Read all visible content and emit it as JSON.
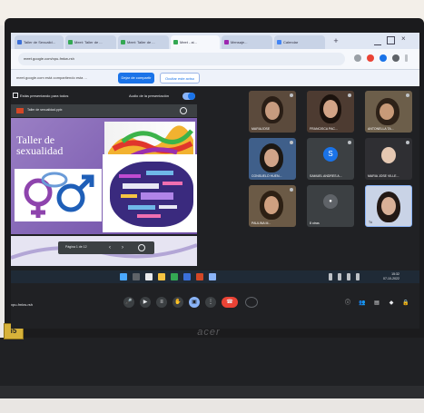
{
  "browser": {
    "tabs": [
      "Taller de Sexualid...",
      "Meet: Taller de ...",
      "Meet: Taller de ...",
      "Meet - ai...",
      "Mensaje...",
      "Calendar"
    ],
    "new_tab": "+",
    "url": "meet.google.com/xpu-fmkw-rsh"
  },
  "infobar": {
    "text": "meet.google.com está compartiendo esta ...",
    "share_label": "Dejar de compartir",
    "hide_label": "Ocultar este aviso"
  },
  "meet": {
    "presenting_label": "Estás presentando para todos",
    "audio_label": "Audio de la presentación",
    "activity_label": "Más actividades",
    "slides_toolbar": "Taller de sexualidad.pptx",
    "slide": {
      "title_line1": "Taller de",
      "title_line2": "sexualidad"
    },
    "slide_control": "Página 1 de 12",
    "meeting_code": "xpu-fmkw-rsh"
  },
  "participants": [
    {
      "name": "MARIAJOSE"
    },
    {
      "name": "FRANCISCA PAC..."
    },
    {
      "name": "ANTONELLA TA..."
    },
    {
      "name": "CONSUELO HUEN..."
    },
    {
      "name": "SAMUEL ANDRES A...",
      "avatar": "S"
    },
    {
      "name": "MARIA JOSE VILLE..."
    },
    {
      "name": "PAULINA M..."
    },
    {
      "name": "8 otras"
    },
    {
      "name": "Tú"
    }
  ],
  "taskbar": {
    "time": "15:32",
    "date": "07-10-2022"
  },
  "laptop": {
    "brand": "acer",
    "sticker": "i5"
  },
  "colors": {
    "meet_bg": "#202124",
    "slide_purple": "#7e5fb2",
    "end_call_red": "#ea4335",
    "share_blue": "#1a73e8"
  }
}
